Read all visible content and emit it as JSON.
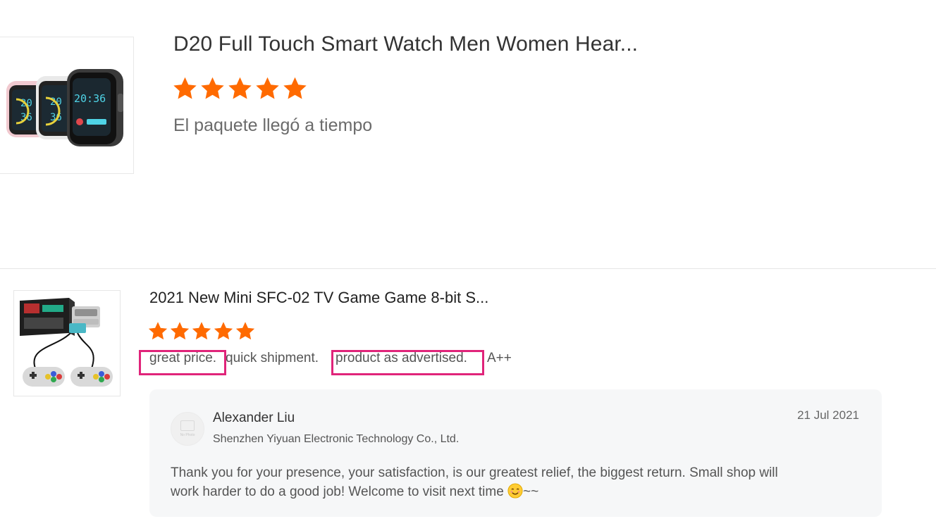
{
  "reviews": [
    {
      "product_title": "D20 Full Touch Smart Watch Men Women Hear...",
      "rating": 5,
      "rating_max": 5,
      "comment": "El paquete llegó a tiempo",
      "star_color": "#ff6a00"
    },
    {
      "product_title": "2021 New Mini SFC-02 TV Game Game 8-bit S...",
      "rating": 5,
      "rating_max": 5,
      "comment_segments": {
        "part1": "great price.",
        "part2": "quick shipment.",
        "part3": "product as advertised.",
        "part4": "A++"
      },
      "highlight_color": "#e0247a",
      "seller_reply": {
        "name": "Alexander Liu",
        "company": "Shenzhen Yiyuan Electronic Technology Co., Ltd.",
        "date": "21 Jul 2021",
        "text_line1": "Thank you for your presence, your satisfaction, is our greatest relief, the biggest return. Small shop will",
        "text_line2": "work harder to do a good job! Welcome to visit next time",
        "text_suffix": "~~",
        "avatar_placeholder": "No Photo"
      }
    }
  ]
}
